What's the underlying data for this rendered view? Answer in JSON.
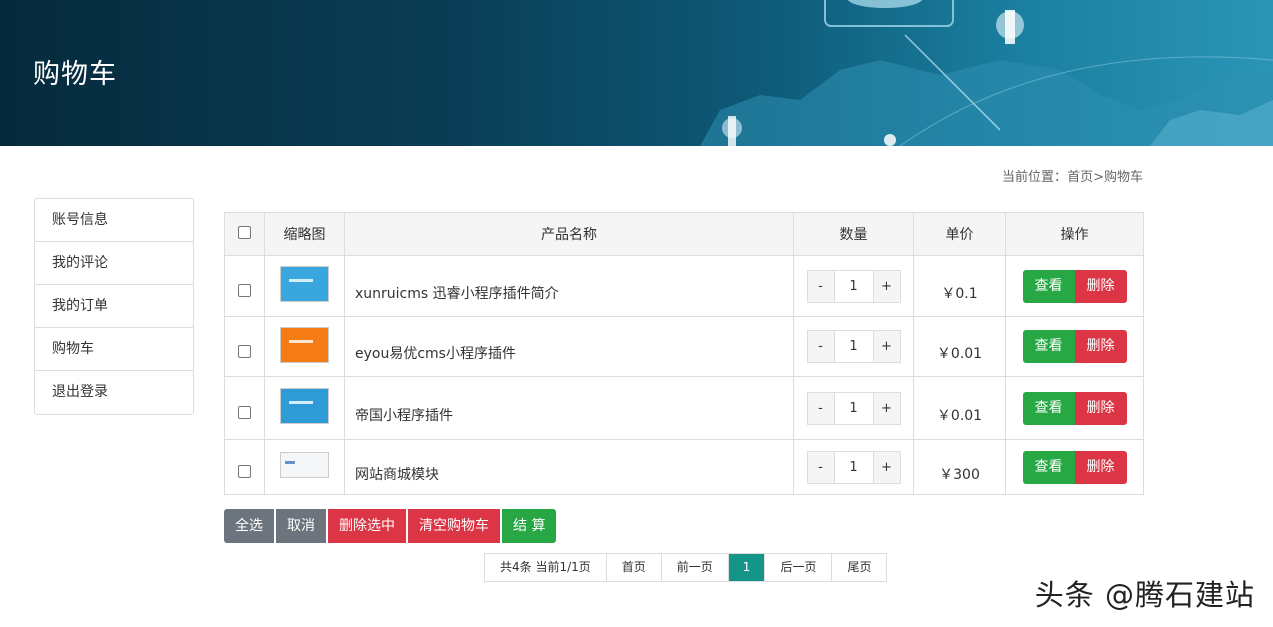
{
  "banner": {
    "title": "购物车"
  },
  "breadcrumb": {
    "prefix": "当前位置：",
    "home": "首页",
    "sep": ">",
    "current": "购物车"
  },
  "sidebar": {
    "items": [
      {
        "label": "账号信息"
      },
      {
        "label": "我的评论"
      },
      {
        "label": "我的订单"
      },
      {
        "label": "购物车"
      },
      {
        "label": "退出登录"
      }
    ]
  },
  "table": {
    "headers": {
      "thumb": "缩略图",
      "name": "产品名称",
      "qty": "数量",
      "price": "单价",
      "op": "操作"
    },
    "rows": [
      {
        "name": "xunruicms 迅睿小程序插件简介",
        "qty": "1",
        "price": "￥0.1",
        "thumb_color": "#3aa6de"
      },
      {
        "name": "eyou易优cms小程序插件",
        "qty": "1",
        "price": "￥0.01",
        "thumb_color": "#f57c14"
      },
      {
        "name": "帝国小程序插件",
        "qty": "1",
        "price": "￥0.01",
        "thumb_color": "#2e9ad6"
      },
      {
        "name": "网站商城模块",
        "qty": "1",
        "price": "￥300",
        "thumb_color": "#f4f6f8"
      }
    ],
    "minus": "-",
    "plus": "+",
    "view_label": "查看",
    "delete_label": "删除"
  },
  "actions": {
    "select_all": "全选",
    "cancel": "取消",
    "delete_selected": "删除选中",
    "clear_cart": "清空购物车",
    "checkout": "结 算"
  },
  "pager": {
    "summary": "共4条 当前1/1页",
    "first": "首页",
    "prev": "前一页",
    "current": "1",
    "next": "后一页",
    "last": "尾页"
  },
  "watermark": "头条 @腾石建站",
  "colors": {
    "green": "#28a745",
    "red": "#dc3545",
    "gray": "#6c757d",
    "teal": "#159488"
  }
}
